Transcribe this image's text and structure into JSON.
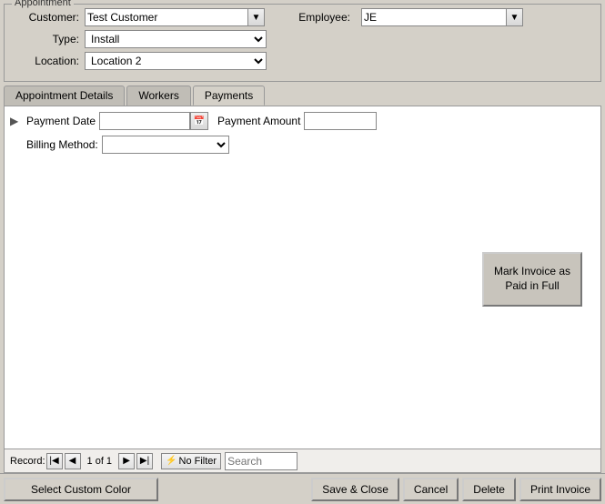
{
  "appointment": {
    "group_label": "Appointment",
    "customer_label": "Customer:",
    "customer_value": "Test Customer",
    "employee_label": "Employee:",
    "employee_value": "JE",
    "type_label": "Type:",
    "type_value": "Install",
    "location_label": "Location:",
    "location_value": "Location 2"
  },
  "tabs": {
    "tab1": "Appointment Details",
    "tab2": "Workers",
    "tab3": "Payments",
    "active": "Payments"
  },
  "payments": {
    "payment_date_label": "Payment Date",
    "payment_amount_label": "Payment Amount",
    "billing_method_label": "Billing Method:",
    "mark_invoice_label": "Mark Invoice as Paid in Full"
  },
  "record_nav": {
    "record_text": "1 of 1",
    "record_prefix": "Record:",
    "no_filter_label": "No Filter",
    "search_placeholder": "Search"
  },
  "bottom_bar": {
    "select_custom_color": "Select Custom Color",
    "save_close": "Save & Close",
    "cancel": "Cancel",
    "delete": "Delete",
    "print_invoice": "Print Invoice"
  }
}
